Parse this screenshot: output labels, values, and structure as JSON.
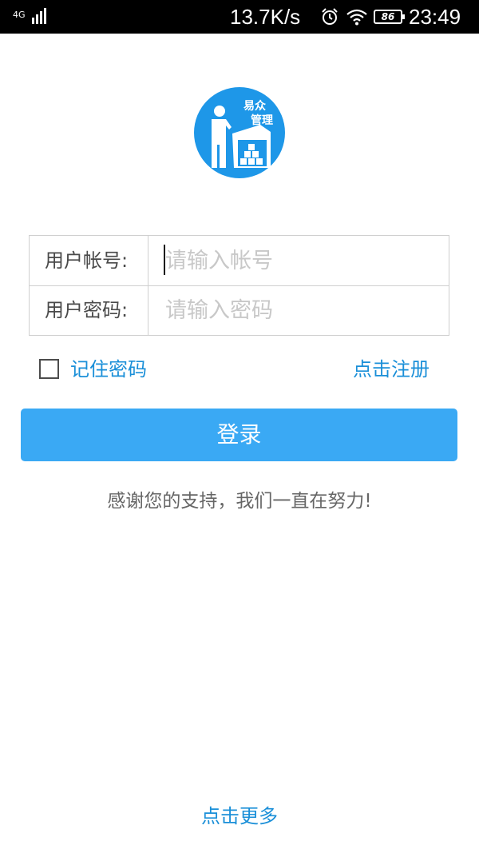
{
  "status_bar": {
    "network": "4G",
    "speed": "13.7K/s",
    "battery": "86",
    "time": "23:49",
    "icons": [
      "signal-icon",
      "alarm-icon",
      "wifi-icon",
      "battery-icon"
    ]
  },
  "logo": {
    "line1": "易众",
    "line2": "管理",
    "color": "#1e97e8"
  },
  "form": {
    "account_label": "用户帐号:",
    "account_placeholder": "请输入帐号",
    "account_value": "",
    "password_label": "用户密码:",
    "password_placeholder": "请输入密码",
    "password_value": ""
  },
  "options": {
    "remember_label": "记住密码",
    "remember_checked": false,
    "register_label": "点击注册"
  },
  "login_button": {
    "label": "登录",
    "color": "#3aa9f4"
  },
  "thanks_text": "感谢您的支持，我们一直在努力!",
  "more_label": "点击更多",
  "colors": {
    "link": "#1a8fd8",
    "border": "#cfcfcf"
  }
}
